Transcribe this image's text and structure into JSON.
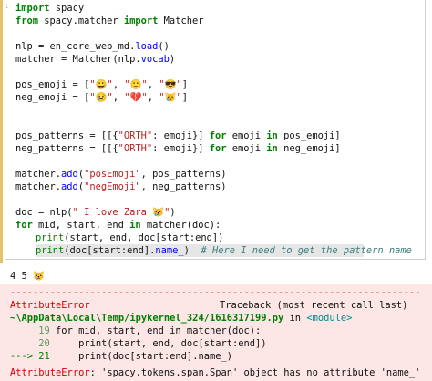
{
  "code": {
    "l1": {
      "kw": "import",
      "rest": " spacy"
    },
    "l2": {
      "kw1": "from",
      "mod": " spacy.matcher ",
      "kw2": "import",
      "rest": " Matcher"
    },
    "l4": {
      "a": "nlp = en_core_web_md.",
      "b": "load",
      "c": "()"
    },
    "l5": {
      "a": "matcher = Matcher(nlp.",
      "b": "vocab",
      "c": ")"
    },
    "l7": {
      "a": "pos_emoji = [",
      "s1": "\"😀\"",
      "c1": ", ",
      "s2": "\"🙂\"",
      "c2": ", ",
      "s3": "\"😎\"",
      "e": "]"
    },
    "l8": {
      "a": "neg_emoji = [",
      "s1": "\"😢\"",
      "c1": ", ",
      "s2": "\"💔\"",
      "c2": ", ",
      "s3": "\"😿\"",
      "e": "]"
    },
    "l11": {
      "a": "pos_patterns = [[{",
      "s": "\"ORTH\"",
      "b": ": emoji}] ",
      "kw1": "for",
      "c": " emoji ",
      "kw2": "in",
      "d": " pos_emoji]"
    },
    "l12": {
      "a": "neg_patterns = [[{",
      "s": "\"ORTH\"",
      "b": ": emoji}] ",
      "kw1": "for",
      "c": " emoji ",
      "kw2": "in",
      "d": " neg_emoji]"
    },
    "l14": {
      "a": "matcher.",
      "b": "add",
      "c": "(",
      "s": "\"posEmoji\"",
      "d": ", pos_patterns)"
    },
    "l15": {
      "a": "matcher.",
      "b": "add",
      "c": "(",
      "s": "\"negEmoji\"",
      "d": ", neg_patterns)"
    },
    "l18": {
      "a": "doc = nlp(",
      "s": "\" I love Zara 😿\"",
      "b": ")"
    },
    "l19": {
      "kw1": "for",
      "a": " mid, start, end ",
      "kw2": "in",
      "b": " matcher(doc):"
    },
    "l20": {
      "fn": "print",
      "a": "(start, end, doc[start:end])"
    },
    "l21": {
      "fn": "print",
      "a": "(doc[start:end].",
      "b": "name_",
      "c": ")  ",
      "cm": "# Here I need to get the pattern name"
    }
  },
  "output": {
    "std": "4 5 😿",
    "dashes": "------------------------------------------------------------------------",
    "err_name": "AttributeError",
    "traceback": "Traceback (most recent call last)",
    "file_path": "~\\AppData\\Local\\Temp/ipykernel_324/1616317199.py",
    "in_word": " in ",
    "module": "<module>",
    "tb1_num": "19",
    "tb1_code": " for mid, start, end in matcher(doc):",
    "tb2_num": "20",
    "tb2_code": "     print(start, end, doc[start:end])",
    "arrow": "---> 21",
    "tb3_code": "     print(doc[start:end].name_)",
    "final_name": "AttributeError",
    "final_msg": ": 'spacy.tokens.span.Span' object has no attribute 'name_'"
  }
}
